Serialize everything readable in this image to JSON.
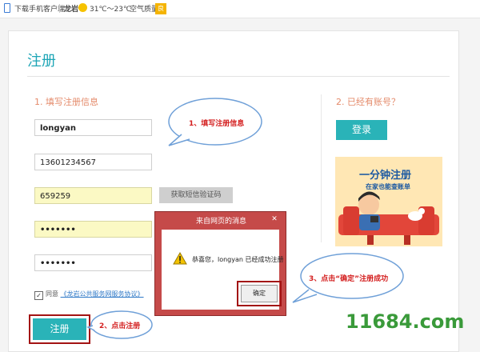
{
  "topbar": {
    "download": "下载手机客户端",
    "city": "龙岩",
    "temperature": "31℃～23℃",
    "air_quality_label": "空气质量：",
    "air_quality_value": "良"
  },
  "page": {
    "title": "注册",
    "section1": "1. 填写注册信息",
    "section2": "2. 已经有账号？"
  },
  "form": {
    "username": "longyan",
    "phone": "13601234567",
    "sms_code": "659259",
    "sms_button": "获取短信验证码",
    "password": "•••••••",
    "password_confirm": "•••••••",
    "agree_prefix": "同意",
    "agree_link": "《龙岩公共服务网服务协议》",
    "checked_mark": "✓",
    "register_button": "注册"
  },
  "side": {
    "login_button": "登录",
    "promo_line1": "一分钟注册",
    "promo_line2": "在家也能查账单"
  },
  "dialog": {
    "title": "来自网页的消息",
    "close": "✕",
    "message": "恭喜您，longyan 已经成功注册",
    "ok_button": "确定"
  },
  "annotations": {
    "step1": "1、填写注册信息",
    "step2": "2、点击注册",
    "step3": "3、点击“确定”注册成功"
  },
  "watermark": "11684.com",
  "colors": {
    "accent": "#2ab3b8",
    "annotation": "#d42020",
    "dialog": "#c54a49"
  }
}
